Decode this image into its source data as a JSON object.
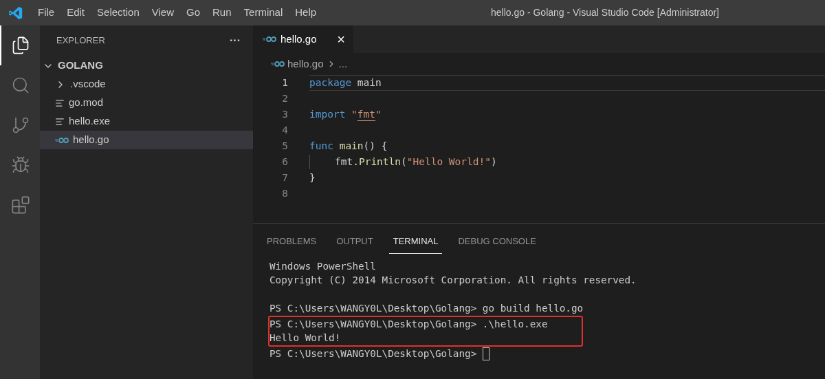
{
  "window": {
    "title": "hello.go - Golang - Visual Studio Code [Administrator]"
  },
  "menu": [
    "File",
    "Edit",
    "Selection",
    "View",
    "Go",
    "Run",
    "Terminal",
    "Help"
  ],
  "activity_bar": [
    {
      "kind": "files",
      "selected": true
    },
    {
      "kind": "search",
      "selected": false
    },
    {
      "kind": "source-control",
      "selected": false
    },
    {
      "kind": "debug",
      "selected": false
    },
    {
      "kind": "extensions",
      "selected": false
    }
  ],
  "sidebar": {
    "title": "EXPLORER",
    "more": "···",
    "tree": [
      {
        "label": "GOLANG",
        "kind": "root",
        "expanded": true,
        "selected": false,
        "children": [
          {
            "label": ".vscode",
            "kind": "folder",
            "expanded": false,
            "selected": false
          },
          {
            "label": "go.mod",
            "kind": "file",
            "selected": false
          },
          {
            "label": "hello.exe",
            "kind": "file",
            "selected": false
          },
          {
            "label": "hello.go",
            "kind": "go",
            "selected": true
          }
        ]
      }
    ]
  },
  "editor": {
    "tabs": [
      {
        "label": "hello.go",
        "kind": "go",
        "selected": true,
        "close": "×"
      }
    ],
    "breadcrumb": {
      "file": "hello.go",
      "rest": "..."
    },
    "lines": [
      {
        "number": "1",
        "current": true,
        "tokens": [
          {
            "kind": "keyword",
            "text": "package"
          },
          {
            "kind": "plain",
            "text": " main"
          }
        ]
      },
      {
        "number": "2",
        "current": false
      },
      {
        "number": "3",
        "current": false,
        "tokens": [
          {
            "kind": "keyword",
            "text": "import"
          },
          {
            "kind": "string",
            "text": " \""
          },
          {
            "kind": "link",
            "text": "fmt"
          },
          {
            "kind": "string",
            "text": "\""
          }
        ]
      },
      {
        "number": "4",
        "current": false
      },
      {
        "number": "5",
        "current": false,
        "tokens": [
          {
            "kind": "keyword",
            "text": "func"
          },
          {
            "kind": "function",
            "text": " main"
          },
          {
            "kind": "plain",
            "text": "() {"
          }
        ]
      },
      {
        "number": "6",
        "current": false,
        "indent": true,
        "tokens": [
          {
            "kind": "plain",
            "text": "fmt."
          },
          {
            "kind": "function",
            "text": "Println"
          },
          {
            "kind": "plain",
            "text": "("
          },
          {
            "kind": "string",
            "text": "\"Hello World!\""
          },
          {
            "kind": "plain",
            "text": ")"
          }
        ]
      },
      {
        "number": "7",
        "current": false,
        "tokens": [
          {
            "kind": "plain",
            "text": "}"
          }
        ]
      },
      {
        "number": "8",
        "current": false
      }
    ]
  },
  "panel": {
    "tabs": [
      {
        "label": "PROBLEMS",
        "selected": false
      },
      {
        "label": "OUTPUT",
        "selected": false
      },
      {
        "label": "TERMINAL",
        "selected": true
      },
      {
        "label": "DEBUG CONSOLE",
        "selected": false
      }
    ],
    "terminal": [
      {
        "highlighted": false,
        "lines": [
          "Windows PowerShell",
          "Copyright (C) 2014 Microsoft Corporation. All rights reserved."
        ]
      },
      {
        "highlighted": false,
        "blank_line_before": true,
        "lines": [
          "PS C:\\Users\\WANGY0L\\Desktop\\Golang> go build hello.go"
        ]
      },
      {
        "highlighted": true,
        "lines": [
          "PS C:\\Users\\WANGY0L\\Desktop\\Golang> .\\hello.exe",
          "Hello World!"
        ]
      },
      {
        "highlighted": false,
        "cursor": true,
        "lines": [
          "PS C:\\Users\\WANGY0L\\Desktop\\Golang> "
        ]
      }
    ]
  }
}
